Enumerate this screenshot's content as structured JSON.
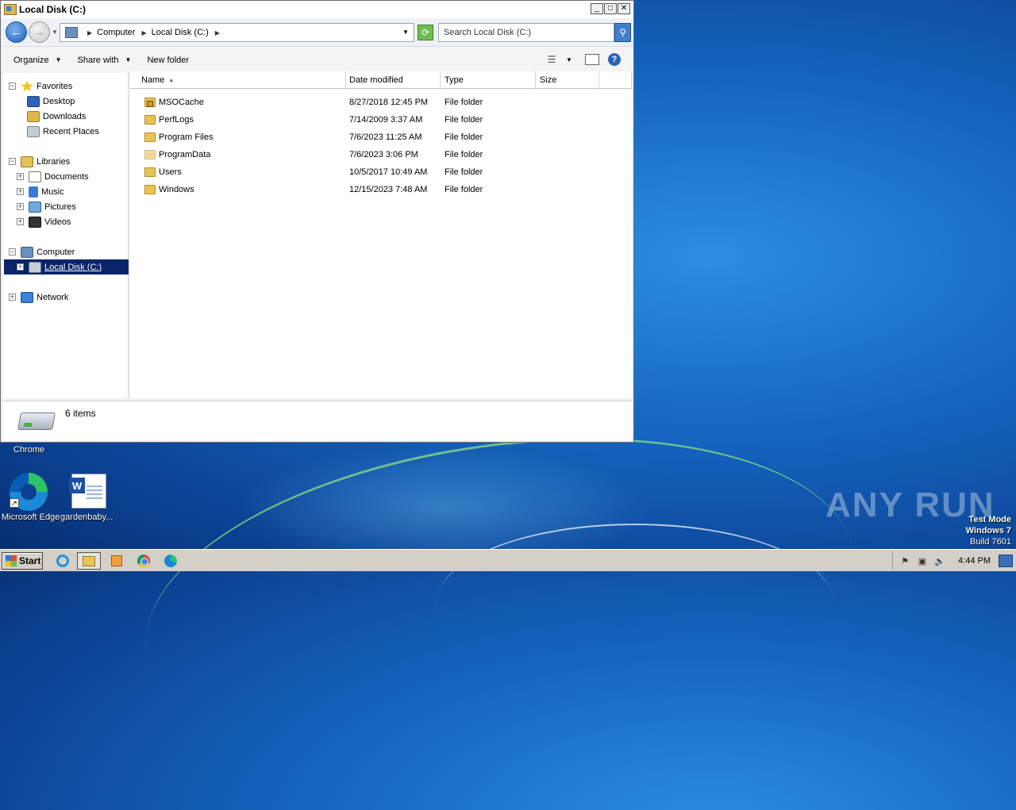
{
  "window": {
    "title": "Local Disk (C:)",
    "controls": {
      "minimize": "_",
      "maximize": "□",
      "close": "✕"
    }
  },
  "address": {
    "breadcrumbs": [
      "Computer",
      "Local Disk (C:)"
    ],
    "search_placeholder": "Search Local Disk (C:)"
  },
  "toolbar": {
    "organize": "Organize",
    "share_with": "Share with",
    "new_folder": "New folder"
  },
  "nav": {
    "favorites": "Favorites",
    "desktop": "Desktop",
    "downloads": "Downloads",
    "recent_places": "Recent Places",
    "libraries": "Libraries",
    "documents": "Documents",
    "music": "Music",
    "pictures": "Pictures",
    "videos": "Videos",
    "computer": "Computer",
    "local_disk": "Local Disk (C:)",
    "network": "Network"
  },
  "columns": {
    "name": "Name",
    "date": "Date modified",
    "type": "Type",
    "size": "Size"
  },
  "files": [
    {
      "name": "MSOCache",
      "date": "8/27/2018 12:45 PM",
      "type": "File folder",
      "size": ""
    },
    {
      "name": "PerfLogs",
      "date": "7/14/2009 3:37 AM",
      "type": "File folder",
      "size": ""
    },
    {
      "name": "Program Files",
      "date": "7/6/2023 11:25 AM",
      "type": "File folder",
      "size": ""
    },
    {
      "name": "ProgramData",
      "date": "7/6/2023 3:06 PM",
      "type": "File folder",
      "size": ""
    },
    {
      "name": "Users",
      "date": "10/5/2017 10:49 AM",
      "type": "File folder",
      "size": ""
    },
    {
      "name": "Windows",
      "date": "12/15/2023 7:48 AM",
      "type": "File folder",
      "size": ""
    }
  ],
  "status": {
    "items": "6 items"
  },
  "desktop": {
    "chrome_label": "Chrome",
    "edge_label": "Microsoft Edge",
    "doc_label": "gardenbaby..."
  },
  "watermark": {
    "brand": "ANY RUN",
    "line1": "Test Mode",
    "line2": "Windows 7",
    "line3": "Build 7601"
  },
  "taskbar": {
    "start": "Start",
    "clock": "4:44 PM"
  }
}
